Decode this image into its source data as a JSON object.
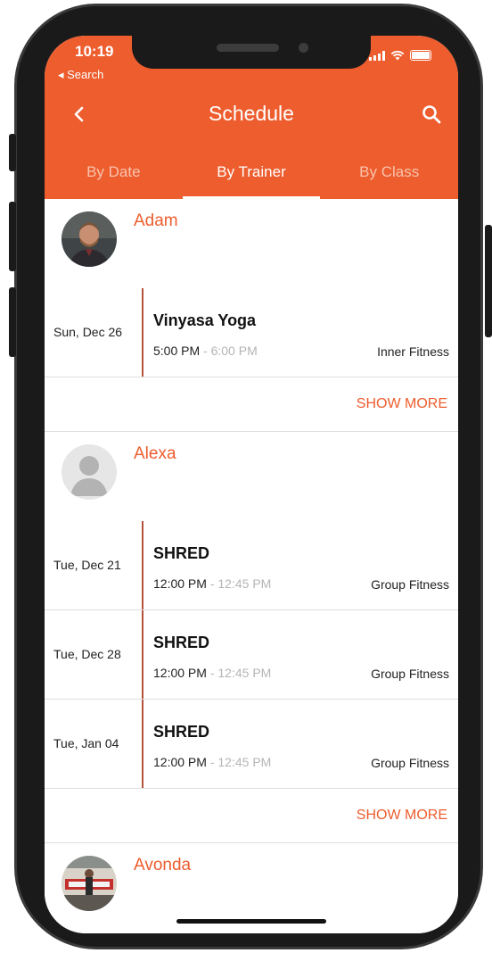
{
  "status_bar": {
    "time": "10:19",
    "back_label": "◂ Search"
  },
  "header": {
    "title": "Schedule",
    "back_icon": "chevron-left-icon",
    "search_icon": "search-icon",
    "accent_color": "#ed5d2e"
  },
  "tabs": [
    {
      "label": "By Date",
      "active": false
    },
    {
      "label": "By Trainer",
      "active": true
    },
    {
      "label": "By Class",
      "active": false
    }
  ],
  "trainers": [
    {
      "name": "Adam",
      "avatar": "photo",
      "sessions": [
        {
          "date": "Sun, Dec 26",
          "class": "Vinyasa Yoga",
          "start": "5:00 PM",
          "end": "6:00 PM",
          "location": "Inner Fitness"
        }
      ],
      "show_more": "SHOW MORE"
    },
    {
      "name": "Alexa",
      "avatar": "placeholder",
      "sessions": [
        {
          "date": "Tue, Dec 21",
          "class": "SHRED",
          "start": "12:00 PM",
          "end": "12:45 PM",
          "location": "Group Fitness"
        },
        {
          "date": "Tue, Dec 28",
          "class": "SHRED",
          "start": "12:00 PM",
          "end": "12:45 PM",
          "location": "Group Fitness"
        },
        {
          "date": "Tue, Jan 04",
          "class": "SHRED",
          "start": "12:00 PM",
          "end": "12:45 PM",
          "location": "Group Fitness"
        }
      ],
      "show_more": "SHOW MORE"
    },
    {
      "name": "Avonda",
      "avatar": "photo",
      "sessions": [],
      "show_more": ""
    }
  ]
}
